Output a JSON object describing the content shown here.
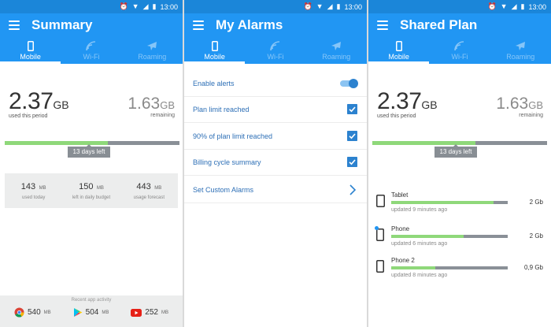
{
  "status_bar": {
    "time": "13:00"
  },
  "tabs": {
    "mobile": "Mobile",
    "wifi": "Wi-Fi",
    "roaming": "Roaming"
  },
  "colors": {
    "appbar": "#2196f3",
    "statusbar": "#1b86d9",
    "accent": "#2c82cf",
    "used": "#8fd87a",
    "remaining": "#8a9097"
  },
  "summary": {
    "title": "Summary",
    "used": {
      "value": "2.37",
      "unit": "GB",
      "label": "used this period"
    },
    "remaining": {
      "value": "1.63",
      "unit": "GB",
      "label": "remaining"
    },
    "usage_fraction": 0.59,
    "days_left": "13 days left",
    "stats": [
      {
        "value": "143",
        "unit": "MB",
        "label": "used today"
      },
      {
        "value": "150",
        "unit": "MB",
        "label": "left in daily budget"
      },
      {
        "value": "443",
        "unit": "MB",
        "label": "usage forecast"
      }
    ],
    "recent_heading": "Recent app activity",
    "apps": [
      {
        "icon": "chrome-icon",
        "value": "540",
        "unit": "MB"
      },
      {
        "icon": "play-store-icon",
        "value": "504",
        "unit": "MB"
      },
      {
        "icon": "youtube-icon",
        "value": "252",
        "unit": "MB"
      }
    ]
  },
  "alarms": {
    "title": "My Alarms",
    "enable_alerts": "Enable alerts",
    "items": [
      {
        "label": "Plan limit reached",
        "checked": true
      },
      {
        "label": "90% of plan limit reached",
        "checked": true
      },
      {
        "label": "Billing cycle summary",
        "checked": true
      }
    ],
    "custom": "Set Custom Alarms"
  },
  "shared": {
    "title": "Shared Plan",
    "used": {
      "value": "2.37",
      "unit": "GB",
      "label": "used this period"
    },
    "remaining": {
      "value": "1.63",
      "unit": "GB",
      "label": "remaining"
    },
    "usage_fraction": 0.59,
    "days_left": "13 days left",
    "devices": [
      {
        "name": "Tablet",
        "updated": "updated 9 minutes ago",
        "amount": "2 Gb",
        "fraction": 0.88
      },
      {
        "name": "Phone",
        "updated": "updated 6 minutes ago",
        "amount": "2 Gb",
        "fraction": 0.62
      },
      {
        "name": "Phone 2",
        "updated": "updated 8 minutes ago",
        "amount": "0,9 Gb",
        "fraction": 0.38
      }
    ]
  }
}
